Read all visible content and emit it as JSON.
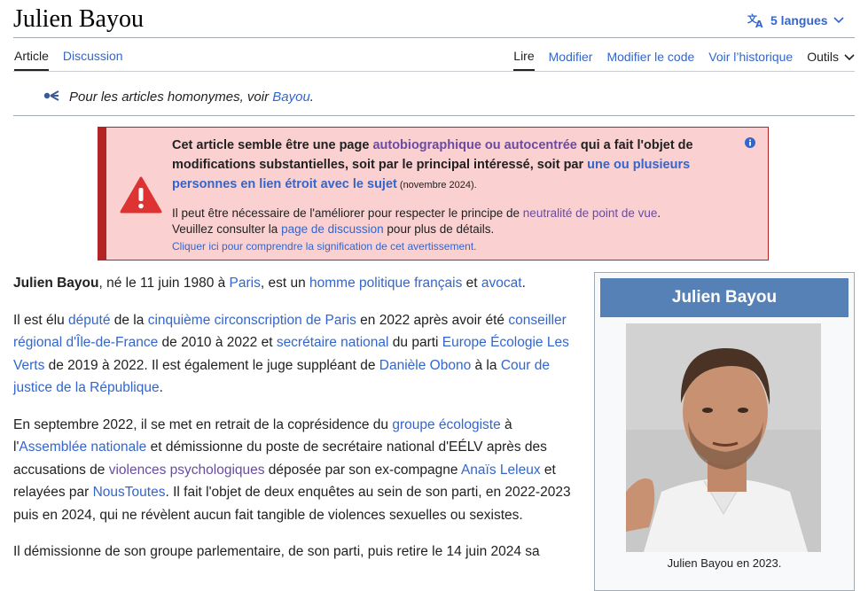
{
  "page": {
    "title": "Julien Bayou",
    "languages": "5 langues"
  },
  "tabs": {
    "left": [
      "Article",
      "Discussion"
    ],
    "right": [
      "Lire",
      "Modifier",
      "Modifier le code",
      "Voir l’historique",
      "Outils"
    ]
  },
  "hatnote": {
    "text": "Pour les articles homonymes, voir ",
    "link": "Bayou",
    "end": "."
  },
  "ambox": {
    "p1": "Cet article semble être une page ",
    "l1": "autobiographique ou autocentrée",
    "p2": " qui a fait l'objet de modifications substantielles, soit par le principal intéressé, soit par ",
    "l2": "une ou plusieurs personnes en lien étroit avec le sujet",
    "date": " (novembre 2024).",
    "s1": "Il peut être nécessaire de l'améliorer pour respecter le principe de ",
    "sl1": "neutralité de point de vue",
    "s2": ".",
    "s3": "Veuillez consulter la ",
    "sl2": "page de discussion",
    "s4": " pour plus de détails.",
    "note": "Cliquer ici pour comprendre la signification de cet avertissement."
  },
  "para1": {
    "b": "Julien Bayou",
    "t1": ", né le 11 juin 1980 à ",
    "l1": "Paris",
    "t2": ", est un ",
    "l2": "homme politique français",
    "t3": " et ",
    "l3": "avocat",
    "t4": "."
  },
  "para2": {
    "t1": "Il est élu ",
    "l1": "député",
    "t2": " de la ",
    "l2": "cinquième circonscription de Paris",
    "t3": " en 2022 après avoir été ",
    "l3": "conseiller régional d'Île-de-France",
    "t4": " de 2010 à 2022 et ",
    "l4": "secrétaire national",
    "t5": " du parti ",
    "l5": "Europe Écologie Les Verts",
    "t6": " de 2019 à 2022. Il est également le juge suppléant de ",
    "l6": "Danièle Obono",
    "t7": " à la ",
    "l7": "Cour de justice de la République",
    "t8": "."
  },
  "para3": {
    "t1": "En septembre 2022, il se met en retrait de la coprésidence du ",
    "l1": "groupe écologiste",
    "t2": " à l'",
    "l2": "Assemblée nationale",
    "t3": " et démissionne du poste de secrétaire national d'EÉLV après des accusations de ",
    "l3": "violences psychologiques",
    "t4": " déposée par son ex-compagne ",
    "l4": "Anaïs Leleux",
    "t5": " et relayées par ",
    "l5": "NousToutes",
    "t6": ". Il fait l'objet de deux enquêtes au sein de son parti, en 2022-2023 puis en 2024, qui ne révèlent aucun fait tangible de violences sexuelles ou sexistes."
  },
  "para4": {
    "t1": "Il démissionne de son groupe parlementaire, de son parti, puis retire le 14 juin 2024 sa"
  },
  "infobox": {
    "title": "Julien Bayou",
    "caption": "Julien Bayou en 2023."
  },
  "colors": {
    "link": "#3366cc",
    "visited": "#6b4ba1",
    "ambox_bg": "#fbd0d0",
    "ambox_border": "#b32424",
    "infobox_header": "#5581b7"
  },
  "icons": [
    "translate-icon",
    "chevron-down-icon",
    "disambiguation-icon",
    "warning-icon",
    "info-icon"
  ]
}
